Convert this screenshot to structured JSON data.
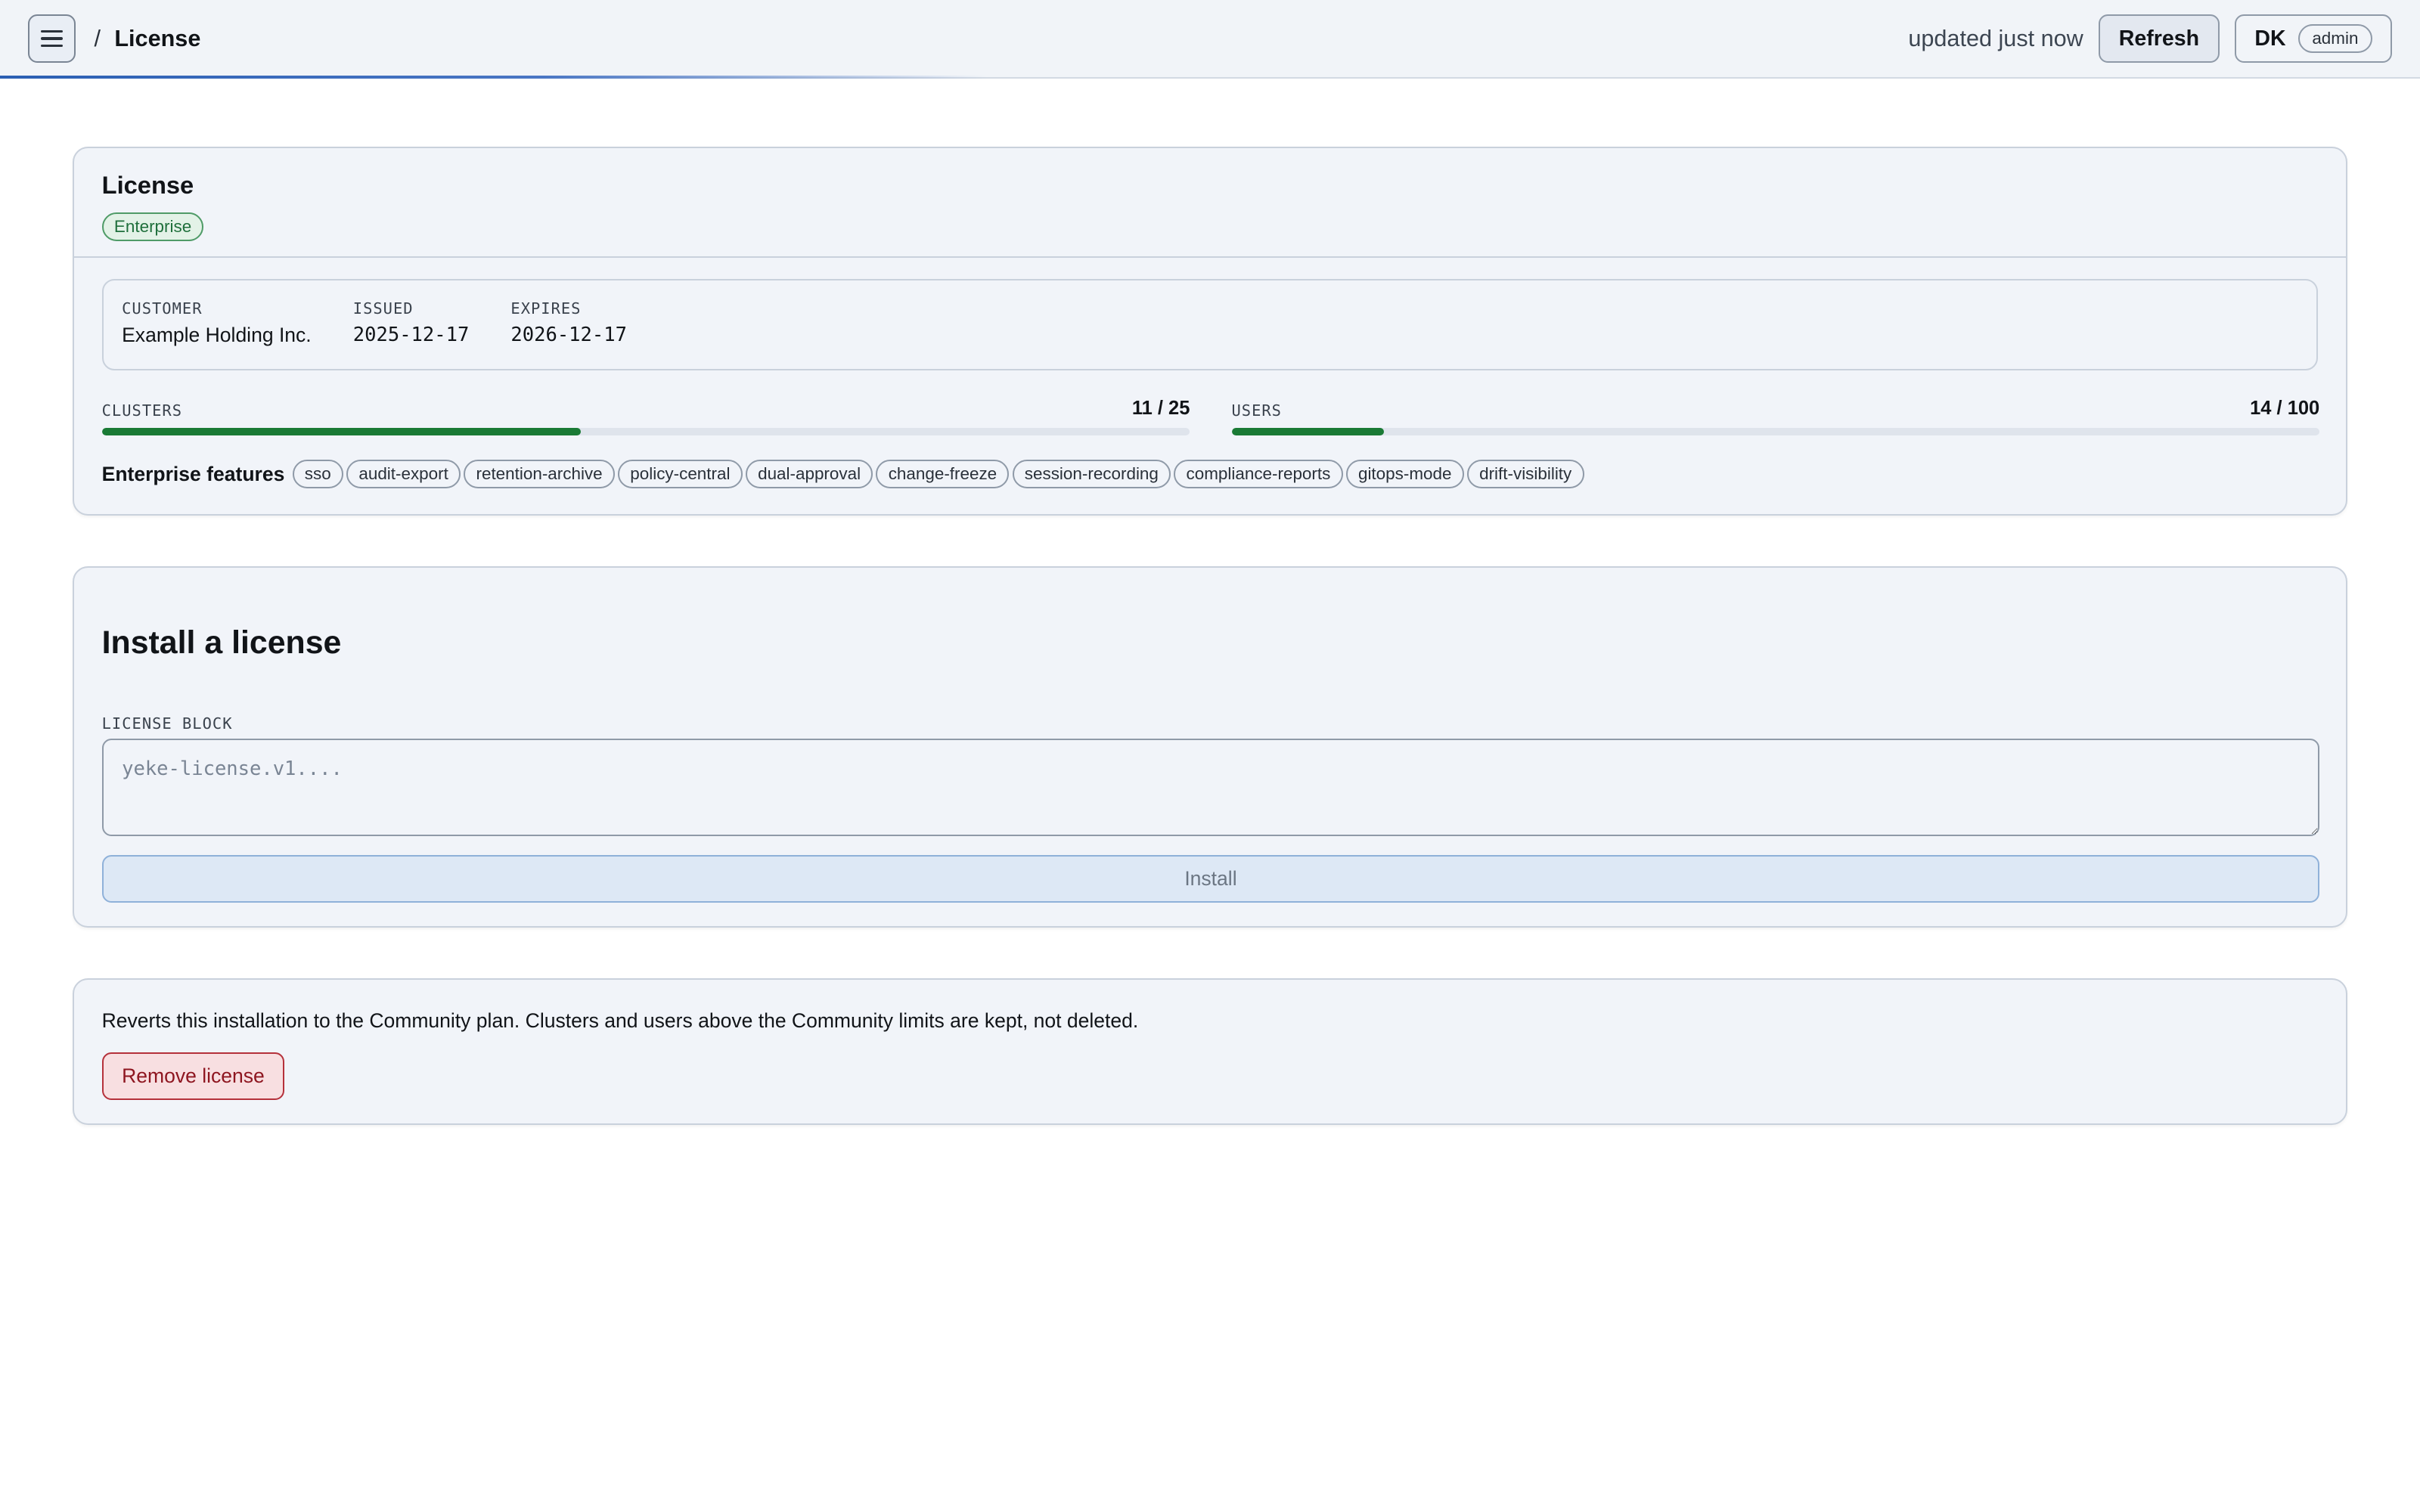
{
  "topbar": {
    "breadcrumb_sep": "/",
    "breadcrumb_current": "License",
    "updated_text": "updated just now",
    "refresh_label": "Refresh",
    "user_initials": "DK",
    "user_role": "admin",
    "menu_icon": "hamburger-menu-icon"
  },
  "license": {
    "title": "License",
    "plan_badge": "Enterprise",
    "customer_label": "CUSTOMER",
    "customer_value": "Example Holding Inc.",
    "issued_label": "ISSUED",
    "issued_value": "2025-12-17",
    "expires_label": "EXPIRES",
    "expires_value": "2026-12-17",
    "clusters_label": "CLUSTERS",
    "clusters_value": "11 / 25",
    "clusters_fraction": 0.44,
    "users_label": "USERS",
    "users_value": "14 / 100",
    "users_fraction": 0.14,
    "features_title": "Enterprise features",
    "features": [
      "sso",
      "audit-export",
      "retention-archive",
      "policy-central",
      "dual-approval",
      "change-freeze",
      "session-recording",
      "compliance-reports",
      "gitops-mode",
      "drift-visibility"
    ]
  },
  "install": {
    "title": "Install a license",
    "field_label": "LICENSE BLOCK",
    "placeholder": "yeke-license.v1....",
    "button_label": "Install"
  },
  "remove": {
    "description": "Reverts this installation to the Community plan. Clusters and users above the Community limits are kept, not deleted.",
    "button_label": "Remove license"
  },
  "colors": {
    "accent_green": "#1a7a35",
    "danger": "#b5313b",
    "accent_blue": "#2b5fb3"
  }
}
